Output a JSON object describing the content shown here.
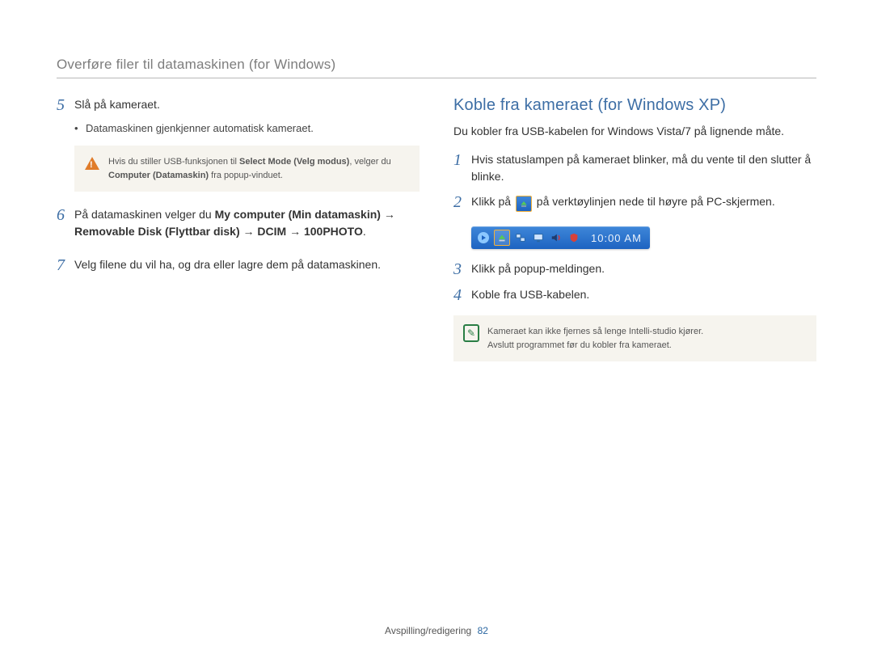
{
  "header": {
    "breadcrumb": "Overføre filer til datamaskinen (for Windows)"
  },
  "left": {
    "steps": {
      "s5": {
        "num": "5",
        "text": "Slå på kameraet."
      },
      "s5_bullet": "Datamaskinen gjenkjenner automatisk kameraet.",
      "s5_note_pre": "Hvis du stiller USB-funksjonen til ",
      "s5_note_b1": "Select Mode (Velg modus)",
      "s5_note_mid": ", velger du ",
      "s5_note_b2": "Computer (Datamaskin)",
      "s5_note_post": " fra popup-vinduet.",
      "s6": {
        "num": "6",
        "t1": "På datamaskinen velger du ",
        "b1": "My computer (Min datamaskin)",
        "arrow1": " → ",
        "b2": "Removable Disk (Flyttbar disk)",
        "arrow2": " → ",
        "b3": "DCIM",
        "arrow3": " → ",
        "b4": "100PHOTO",
        "end": "."
      },
      "s7": {
        "num": "7",
        "text": "Velg filene du vil ha, og dra eller lagre dem på datamaskinen."
      }
    }
  },
  "right": {
    "title": "Koble fra kameraet (for Windows XP)",
    "intro": "Du kobler fra USB-kabelen for Windows Vista/7 på lignende måte.",
    "steps": {
      "s1": {
        "num": "1",
        "text": "Hvis statuslampen på kameraet blinker, må du vente til den slutter å blinke."
      },
      "s2": {
        "num": "2",
        "t1": "Klikk på ",
        "t2": " på verktøylinjen nede til høyre på PC-skjermen."
      },
      "s3": {
        "num": "3",
        "text": "Klikk på popup-meldingen."
      },
      "s4": {
        "num": "4",
        "text": "Koble fra USB-kabelen."
      }
    },
    "tray": {
      "time": "10:00 AM"
    },
    "note": {
      "line1": "Kameraet kan ikke fjernes så lenge Intelli-studio kjører.",
      "line2": "Avslutt programmet før du kobler fra kameraet."
    }
  },
  "footer": {
    "section": "Avspilling/redigering",
    "page": "82"
  },
  "glyphs": {
    "dot": "•"
  }
}
